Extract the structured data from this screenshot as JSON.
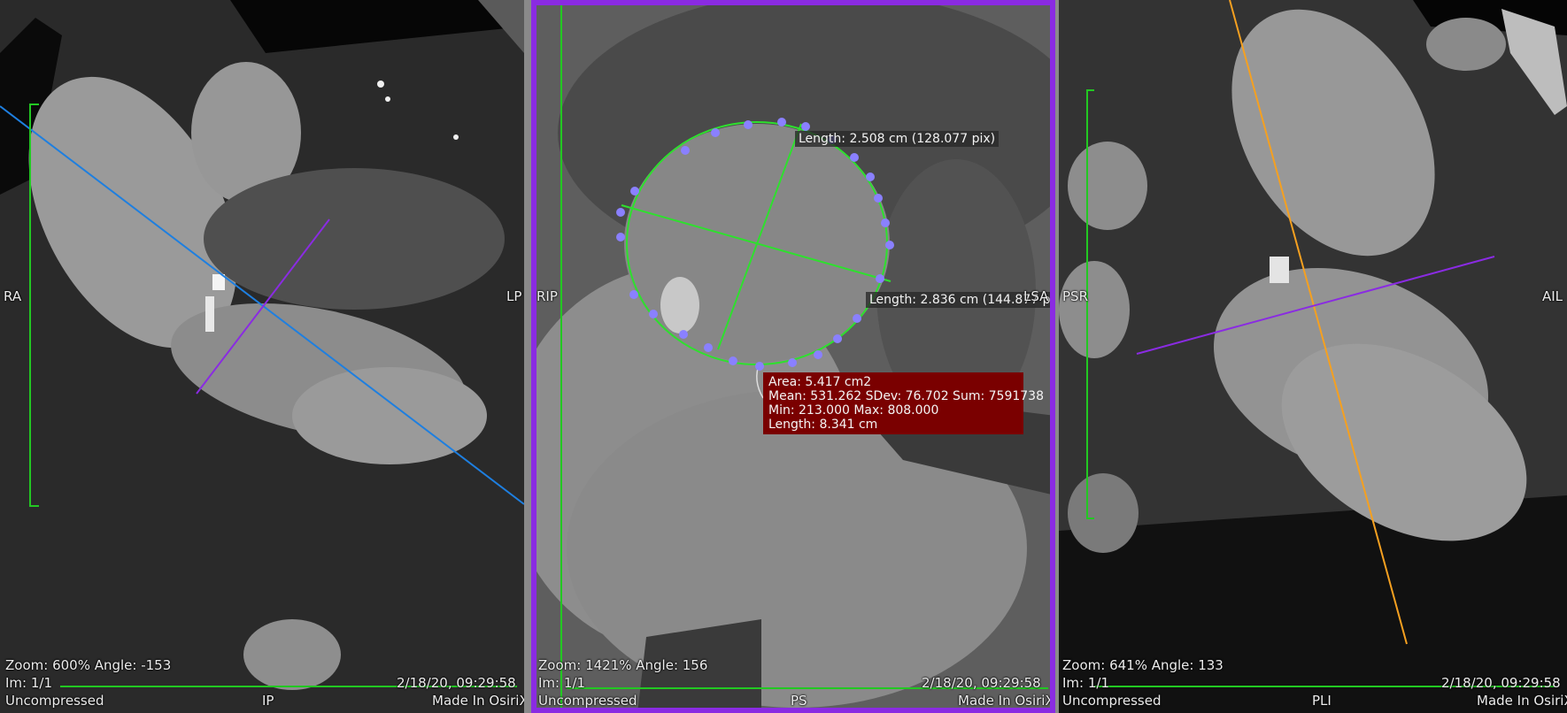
{
  "viewports": {
    "left": {
      "orient_left": "RA",
      "orient_right": "LP",
      "orient_bottom": "IP",
      "zoom_line": "Zoom: 600% Angle: -153",
      "image_index": "Im: 1/1",
      "compression": "Uncompressed",
      "datetime": "2/18/20, 09:29:58",
      "made_in": "Made In OsiriX"
    },
    "middle": {
      "orient_left": "RIP",
      "orient_right": "LSA",
      "orient_bottom": "PS",
      "zoom_line": "Zoom: 1421% Angle: 156",
      "image_index": "Im: 1/1",
      "compression": "Uncompressed",
      "datetime": "2/18/20, 09:29:58",
      "made_in": "Made In OsiriX",
      "measurements": {
        "length1": "Length: 2.508 cm (128.077 pix)",
        "length2": "Length: 2.836 cm (144.877 pix)",
        "roi_stats": {
          "area": "Area: 5.417 cm2",
          "mean": "Mean: 531.262 SDev: 76.702 Sum: 7591738",
          "minmax": "Min: 213.000 Max: 808.000",
          "length": "Length: 8.341 cm"
        }
      }
    },
    "right": {
      "orient_left": "PSR",
      "orient_right": "AIL",
      "orient_bottom": "PLI",
      "zoom_line": "Zoom: 641% Angle: 133",
      "image_index": "Im: 1/1",
      "compression": "Uncompressed",
      "datetime": "2/18/20, 09:29:58",
      "made_in": "Made In OsiriX"
    }
  },
  "colors": {
    "axis_blue": "#1e7fe0",
    "axis_purple": "#8a2be2",
    "axis_orange": "#f5a020",
    "roi_green": "#2ee02e",
    "roi_points": "#8a80ff",
    "scale_green": "#22c822",
    "stats_bg": "#7a0000"
  },
  "icons": [
    "crosshair-line",
    "roi-handle-point",
    "scale-bar"
  ]
}
